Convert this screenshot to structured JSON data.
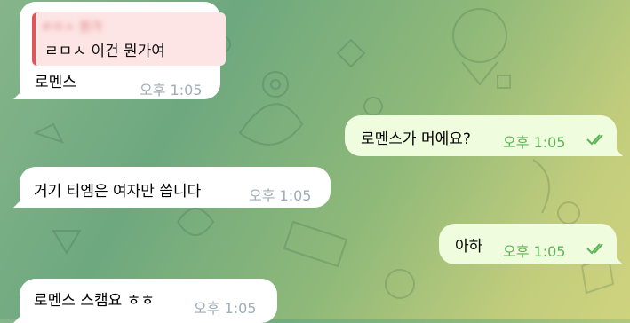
{
  "messages": [
    {
      "id": "m1",
      "direction": "in",
      "reply": {
        "sender": "ㄹㅁㅅ 뭔가",
        "text": "ㄹㅁㅅ 이건 뭔가여"
      },
      "text": "로멘스",
      "time": "오후 1:05"
    },
    {
      "id": "m2",
      "direction": "out",
      "text": "로멘스가 머에요?",
      "time": "오후 1:05",
      "read": true
    },
    {
      "id": "m3",
      "direction": "in",
      "text": "거기 티엠은 여자만 씁니다",
      "time": "오후 1:05"
    },
    {
      "id": "m4",
      "direction": "out",
      "text": "아하",
      "time": "오후 1:05",
      "read": true
    },
    {
      "id": "m5",
      "direction": "in",
      "text": "로멘스 스캠요 ㅎㅎ",
      "time": "오후 1:05"
    }
  ],
  "colors": {
    "incoming": "#ffffff",
    "outgoing": "#effdde",
    "time_out": "#5db356",
    "time_in": "#a0acb6",
    "reply_bar": "#e0555a"
  }
}
